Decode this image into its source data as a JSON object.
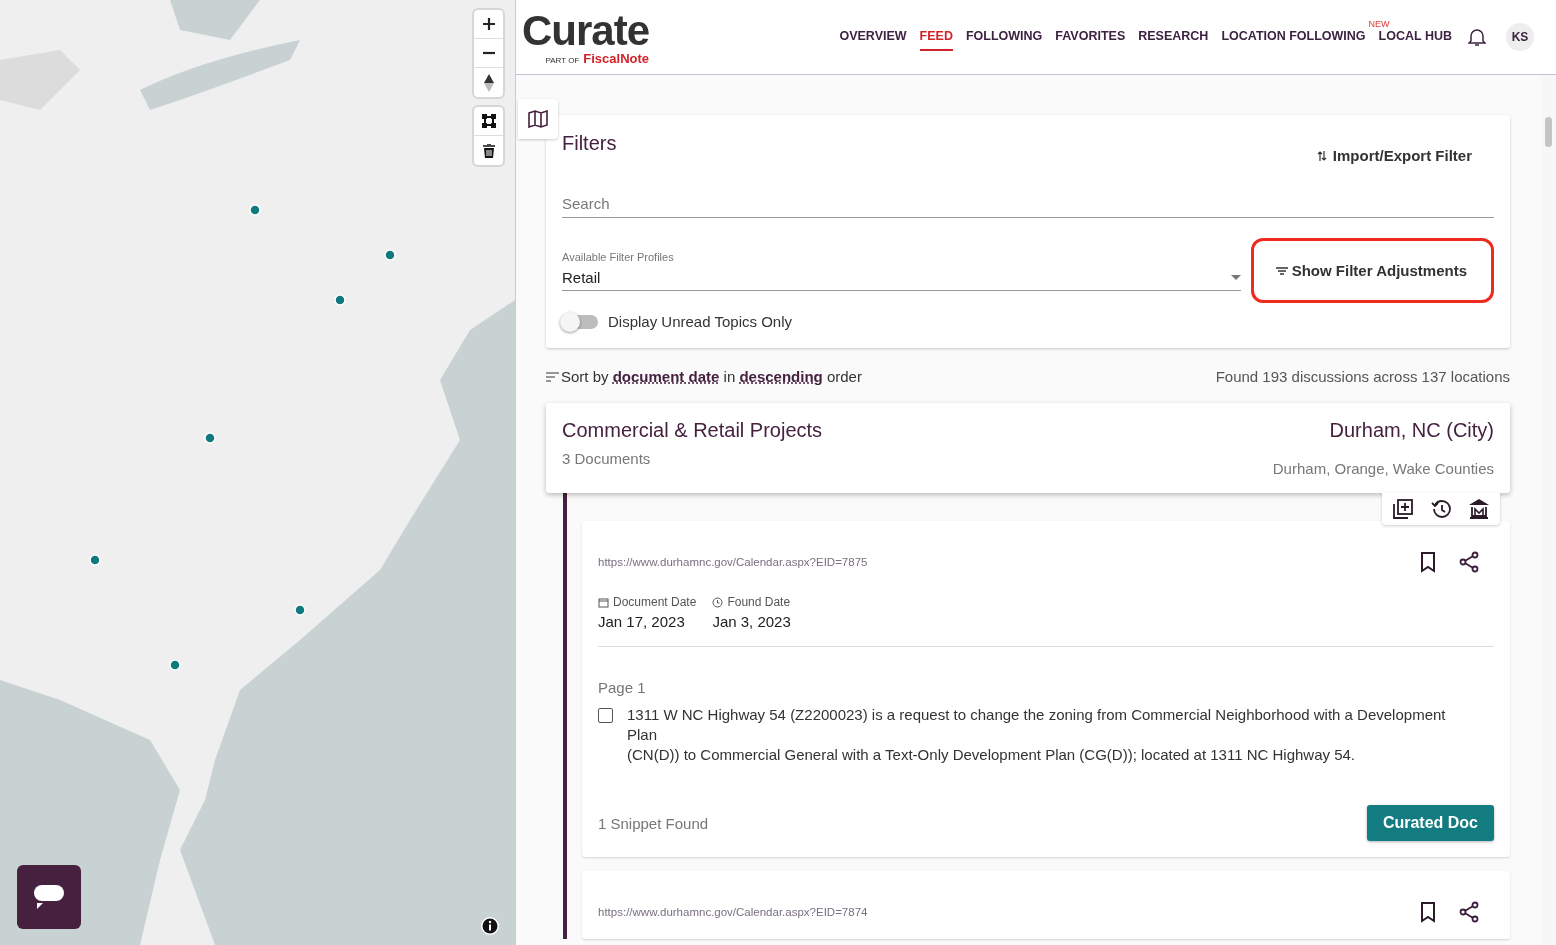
{
  "header": {
    "logo": "Curate",
    "logo_prefix": "PART OF",
    "logo_brand": "FiscalNote",
    "avatar": "KS",
    "nav": [
      {
        "label": "OVERVIEW",
        "selected": false
      },
      {
        "label": "FEED",
        "selected": true
      },
      {
        "label": "FOLLOWING",
        "selected": false
      },
      {
        "label": "FAVORITES",
        "selected": false
      },
      {
        "label": "RESEARCH",
        "selected": false
      },
      {
        "label": "LOCATION FOLLOWING",
        "selected": false,
        "badge": "NEW"
      },
      {
        "label": "LOCAL HUB",
        "selected": false
      }
    ]
  },
  "filters": {
    "title": "Filters",
    "import_export": "Import/Export Filter",
    "search_placeholder": "Search",
    "profile_label": "Available Filter Profiles",
    "profile_value": "Retail",
    "adjustments_button": "Show Filter Adjustments",
    "adjustments_highlighted": true,
    "unread_toggle": {
      "label": "Display Unread Topics Only",
      "on": false
    }
  },
  "sort": {
    "text": "Sort by **document date** in **descending** order",
    "found": "Found 193 discussions across 137 locations"
  },
  "topic": {
    "title": "Commercial & Retail Projects",
    "documents": "3 Documents",
    "location": "Durham, NC (City)",
    "counties": "Durham, Orange, Wake Counties"
  },
  "documents": [
    {
      "url": "https://www.durhamnc.gov/Calendar.aspx?EID=7875",
      "bookmarked": false,
      "document_date_label": "Document Date",
      "document_date": "Jan 17, 2023",
      "found_date_label": "Found Date",
      "found_date": "Jan 3, 2023",
      "page": "Page 1",
      "snippets": [
        {
          "checked": false,
          "text": "1311 W NC Highway 54 (Z2200023) is a request to change the zoning from Commercial Neighborhood with a Development Plan\n(CN(D)) to Commercial General with a Text-Only Development Plan (CG(D)); located at 1311 NC Highway 54."
        }
      ],
      "snippet_count": "1 Snippet Found",
      "button": "Curated Doc"
    },
    {
      "url": "https://www.durhamnc.gov/Calendar.aspx?EID=7874",
      "bookmarked": false
    }
  ]
}
